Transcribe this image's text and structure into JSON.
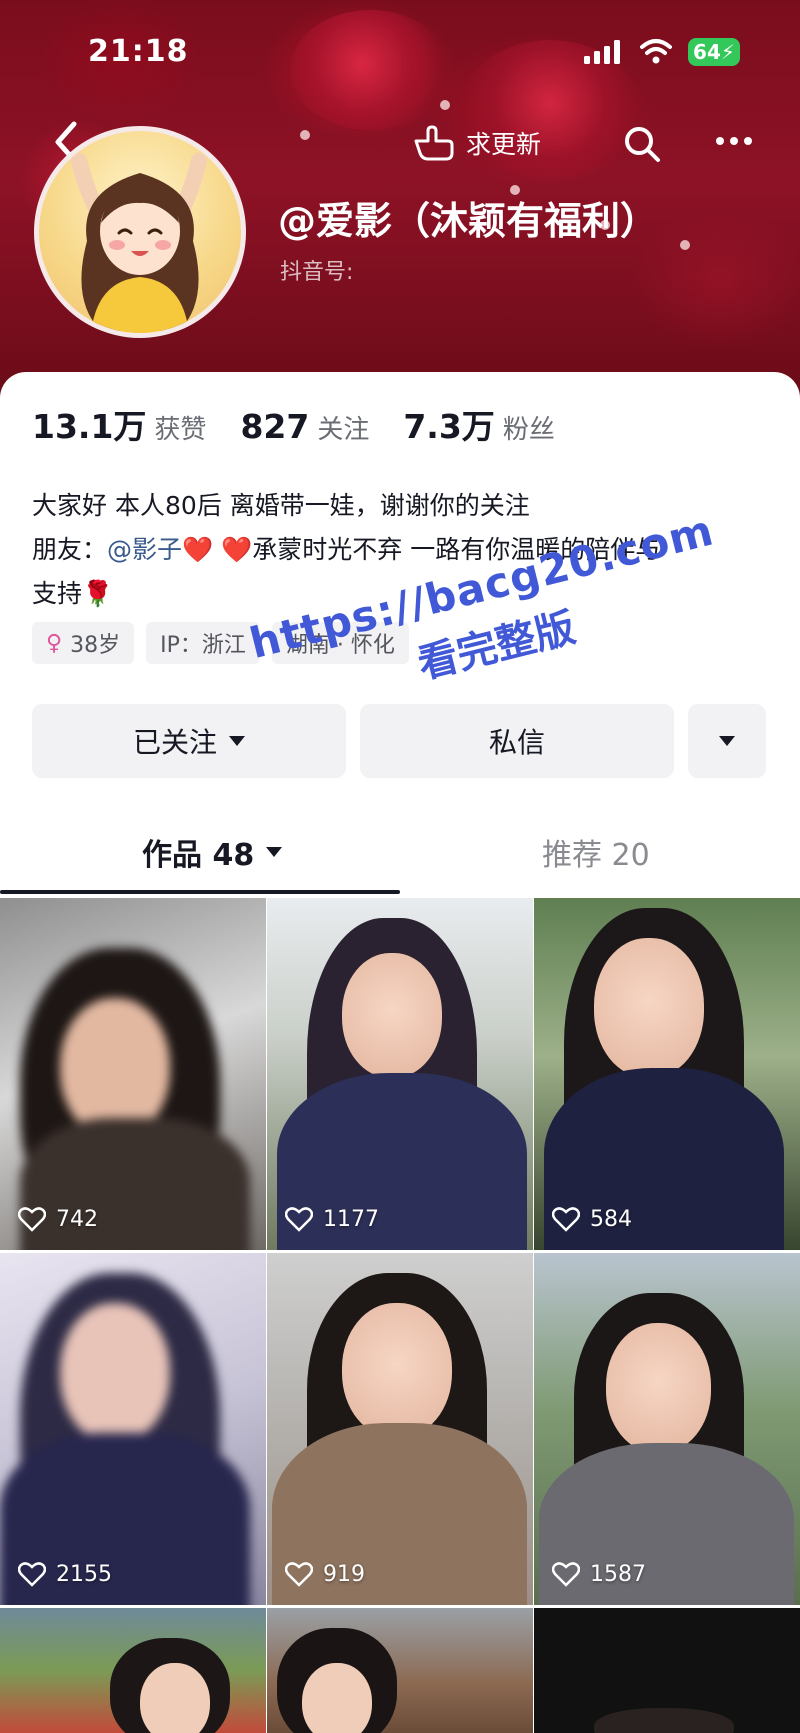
{
  "status_bar": {
    "time": "21:18",
    "battery": "64",
    "icons": [
      "signal-icon",
      "wifi-icon",
      "battery-icon"
    ]
  },
  "top_nav": {
    "back_icon": "chevron-left-icon",
    "request_update_label": "求更新",
    "search_icon": "search-icon",
    "more_icon": "ellipsis-icon"
  },
  "profile": {
    "name": "@爱影（沐颖有福利）",
    "douyin_id_label": "抖音号:",
    "stats": [
      {
        "value": "13.1万",
        "label": "获赞"
      },
      {
        "value": "827",
        "label": "关注"
      },
      {
        "value": "7.3万",
        "label": "粉丝"
      }
    ],
    "bio": {
      "line1": "大家好 本人80后 离婚带一娃，谢谢你的关注",
      "line2_prefix": "朋友：",
      "mention": "@影子",
      "heart1": "❤️",
      "heart2": "❤️",
      "line2_suffix": "承蒙时光不弃 一路有你温暖的陪伴与",
      "line3": "支持",
      "rose": "🌹"
    },
    "tags": [
      {
        "icon": "female-icon",
        "text": "38岁"
      },
      {
        "text": "IP：浙江"
      },
      {
        "text": "湖南 · 怀化"
      }
    ]
  },
  "actions": {
    "follow_label": "已关注",
    "message_label": "私信"
  },
  "tabs": {
    "works_label": "作品 48",
    "recommend_label": "推荐 20"
  },
  "videos": [
    {
      "likes": "742"
    },
    {
      "likes": "1177"
    },
    {
      "likes": "584"
    },
    {
      "likes": "2155"
    },
    {
      "likes": "919"
    },
    {
      "likes": "1587"
    },
    {
      "likes": ""
    },
    {
      "likes": ""
    },
    {
      "likes": ""
    }
  ],
  "watermark": {
    "url": "https://bacg20.com",
    "cta": "看完整版"
  },
  "colors": {
    "header_red": "#8e1226",
    "accent_mention": "#3a5a8c",
    "watermark_blue": "#4159d6",
    "battery_green": "#34c759"
  }
}
